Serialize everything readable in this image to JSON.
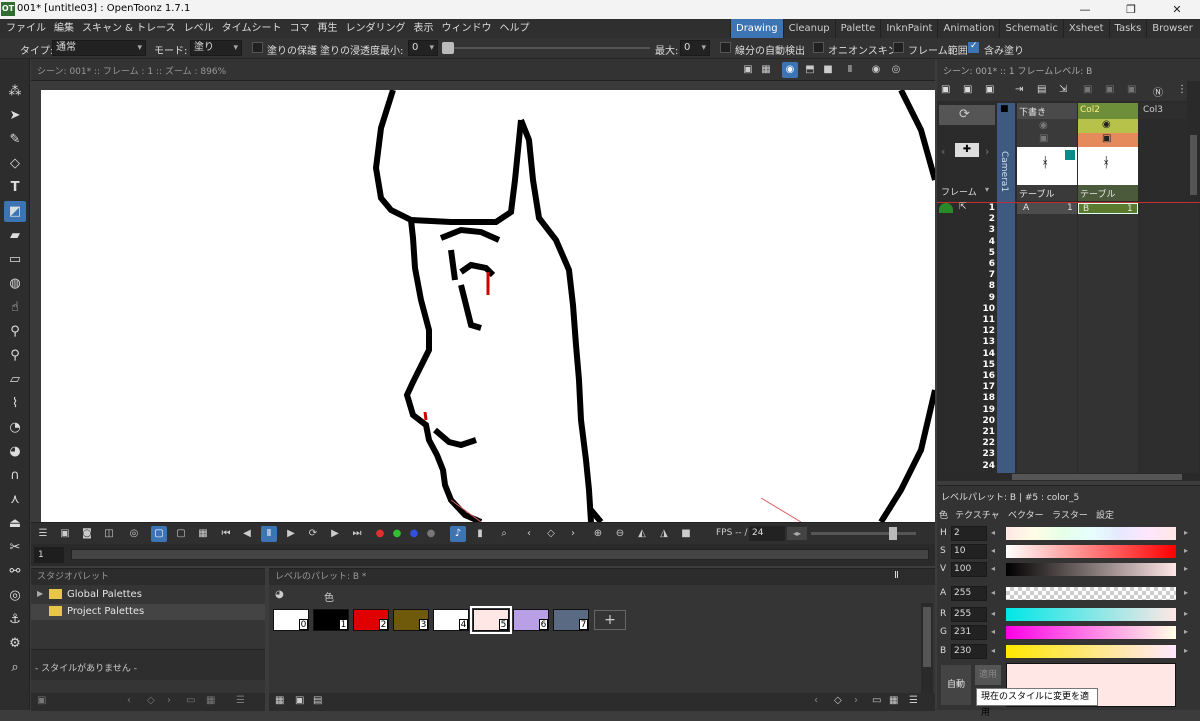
{
  "window": {
    "logo": "OT",
    "title": "001* [untitle03] : OpenToonz 1.7.1"
  },
  "menu": [
    "ファイル",
    "編集",
    "スキャン & トレース",
    "レベル",
    "タイムシート",
    "コマ",
    "再生",
    "レンダリング",
    "表示",
    "ウィンドウ",
    "ヘルプ"
  ],
  "rooms": [
    {
      "label": "Drawing",
      "active": true
    },
    {
      "label": "Cleanup"
    },
    {
      "label": "Palette"
    },
    {
      "label": "InknPaint"
    },
    {
      "label": "Animation"
    },
    {
      "label": "Schematic"
    },
    {
      "label": "Xsheet"
    },
    {
      "label": "Tasks"
    },
    {
      "label": "Browser"
    }
  ],
  "tool_options": {
    "type_label": "タイプ:",
    "type_value": "通常",
    "mode_label": "モード:",
    "mode_value": "塗り",
    "preserve_label": "塗りの保護",
    "depth_label": "塗りの浸透度",
    "min_label": "最小:",
    "min_value": "0",
    "max_label": "最大:",
    "max_value": "0",
    "autoclose_label": "線分の自動検出",
    "onion_label": "オニオンスキン",
    "range_label": "フレーム範囲",
    "selective_label": "含み塗り"
  },
  "viewer": {
    "info": "シーン: 001*  ::  フレーム : 1  ::  ズーム : 896%",
    "frame_field": "1",
    "fps_label": "FPS -- /",
    "fps_value": "24"
  },
  "xsheet": {
    "header": "シーン: 001*  ::  1 フレームレベル: B",
    "frame_label": "フレーム",
    "camera_label": "Camera1",
    "columns": [
      {
        "name": "下書き",
        "sub": "テーブル",
        "cell": "A",
        "num": "1"
      },
      {
        "name": "Col2",
        "sub": "テーブル",
        "cell": "B",
        "num": "1"
      },
      {
        "name": "Col3"
      }
    ],
    "rows": [
      "1",
      "2",
      "3",
      "4",
      "5",
      "6",
      "7",
      "8",
      "9",
      "10",
      "11",
      "12",
      "13",
      "14",
      "15",
      "16",
      "17",
      "18",
      "19",
      "20",
      "21",
      "22",
      "23",
      "24"
    ]
  },
  "studio_palette": {
    "title": "スタジオパレット",
    "items": [
      "Global Palettes",
      "Project Palettes"
    ],
    "empty": "- スタイルがありません -"
  },
  "level_palette": {
    "title": "レベルのパレット: B *",
    "tab_label": "色",
    "swatches": [
      {
        "num": "0",
        "color": "#ffffff"
      },
      {
        "num": "1",
        "color": "#000000"
      },
      {
        "num": "2",
        "color": "#e00000"
      },
      {
        "num": "3",
        "color": "#6e5a0a"
      },
      {
        "num": "4",
        "color": "#ffffff"
      },
      {
        "num": "5",
        "color": "#ffe7e6",
        "selected": true
      },
      {
        "num": "6",
        "color": "#b9a0e6"
      },
      {
        "num": "7",
        "color": "#5a6a82"
      }
    ]
  },
  "style_editor": {
    "header": "レベルパレット: B | #5 : color_5",
    "tabs": [
      "色",
      "テクスチャ",
      "ベクター",
      "ラスター",
      "設定"
    ],
    "channels": [
      {
        "key": "H",
        "value": "2"
      },
      {
        "key": "S",
        "value": "10"
      },
      {
        "key": "V",
        "value": "100"
      },
      {
        "key": "A",
        "value": "255"
      },
      {
        "key": "R",
        "value": "255"
      },
      {
        "key": "G",
        "value": "231"
      },
      {
        "key": "B",
        "value": "230"
      }
    ],
    "auto_label": "自動",
    "apply_label": "適用",
    "tooltip": "現在のスタイルに変更を適用",
    "current_color": "#ffe7e6"
  }
}
